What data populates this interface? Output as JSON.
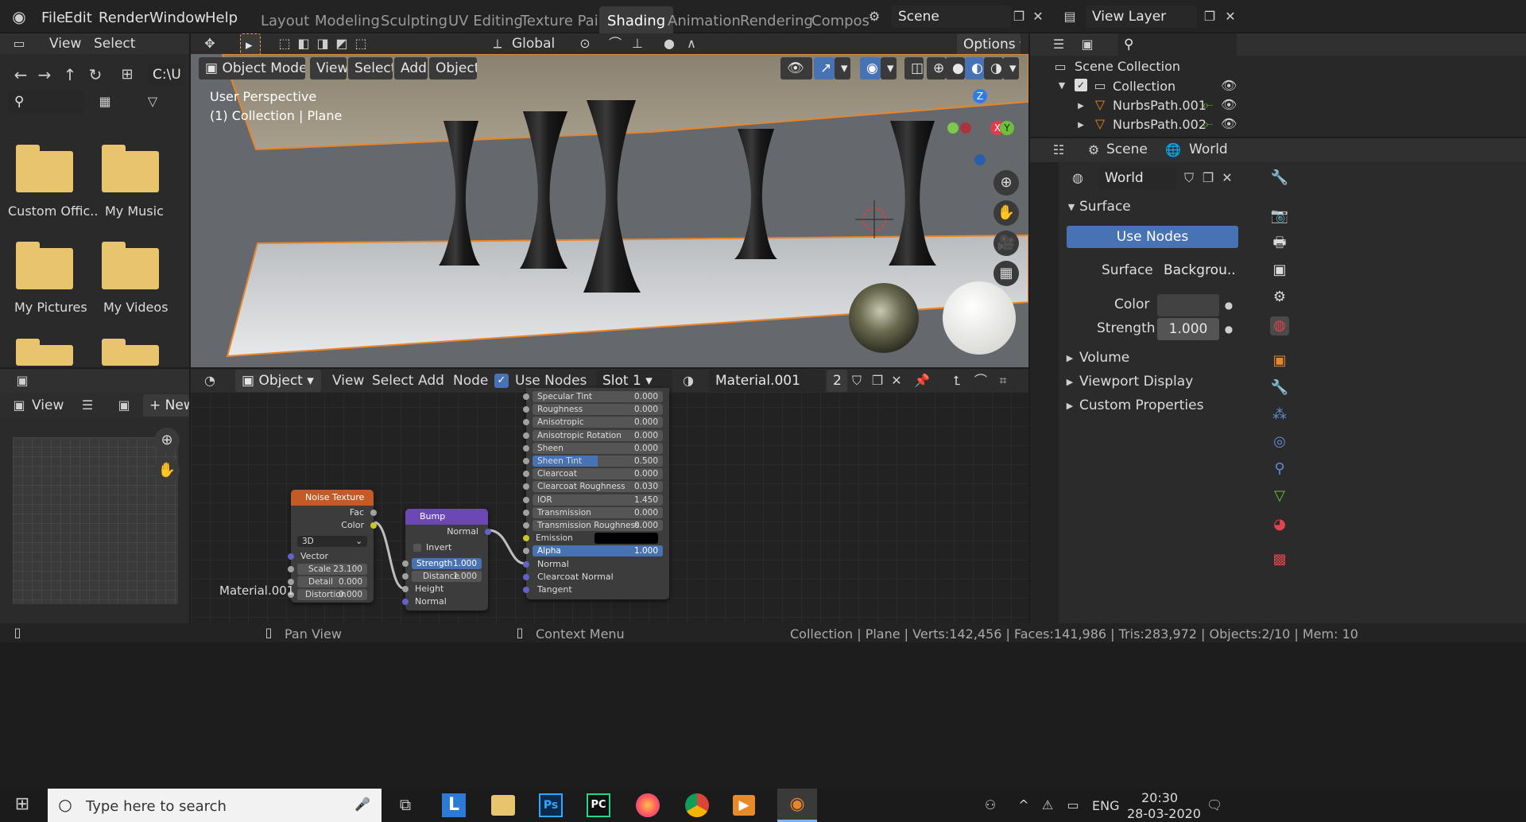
{
  "menu": [
    "File",
    "Edit",
    "Render",
    "Window",
    "Help"
  ],
  "workspaces": [
    "Layout",
    "Modeling",
    "Sculpting",
    "UV Editing",
    "Texture Paint",
    "Shading",
    "Animation",
    "Rendering",
    "Compos"
  ],
  "active_workspace": "Shading",
  "scene_name": "Scene",
  "view_layer": "View Layer",
  "file_browser": {
    "header_view": "View",
    "header_select": "Select",
    "path": "C:\\U",
    "folders": [
      "Custom Offic..",
      "My Music",
      "My Pictures",
      "My Videos",
      "",
      ""
    ]
  },
  "viewport": {
    "mode": "Object Mode",
    "menus": [
      "View",
      "Select",
      "Add",
      "Object"
    ],
    "orientation": "Global",
    "options": "Options",
    "overlay_line1": "User Perspective",
    "overlay_line2": "(1) Collection | Plane",
    "gizmo_z": "Z",
    "gizmo_x": "X",
    "gizmo_y": "Y"
  },
  "image_editor": {
    "view": "View",
    "new": "New"
  },
  "node_editor": {
    "object": "Object",
    "menus": [
      "View",
      "Select",
      "Add",
      "Node"
    ],
    "use_nodes": "Use Nodes",
    "slot": "Slot 1",
    "material": "Material.001",
    "users": "2",
    "material_label": "Material.001"
  },
  "bsdf_rows": [
    {
      "label": "Specular Tint",
      "value": "0.000"
    },
    {
      "label": "Roughness",
      "value": "0.000"
    },
    {
      "label": "Anisotropic",
      "value": "0.000"
    },
    {
      "label": "Anisotropic Rotation",
      "value": "0.000"
    },
    {
      "label": "Sheen",
      "value": "0.000"
    },
    {
      "label": "Sheen Tint",
      "value": "0.500"
    },
    {
      "label": "Clearcoat",
      "value": "0.000"
    },
    {
      "label": "Clearcoat Roughness",
      "value": "0.030"
    },
    {
      "label": "IOR",
      "value": "1.450"
    },
    {
      "label": "Transmission",
      "value": "0.000"
    },
    {
      "label": "Transmission Roughness",
      "value": "0.000"
    },
    {
      "label": "Emission",
      "value": ""
    },
    {
      "label": "Alpha",
      "value": "1.000"
    },
    {
      "label": "Normal",
      "value": ""
    },
    {
      "label": "Clearcoat Normal",
      "value": ""
    },
    {
      "label": "Tangent",
      "value": ""
    }
  ],
  "noise_node": {
    "title": "Noise Texture",
    "fac": "Fac",
    "color": "Color",
    "dim": "3D",
    "vector": "Vector",
    "scale_label": "Scale",
    "scale": "23.100",
    "detail_label": "Detail",
    "detail": "0.000",
    "distortion_label": "Distortion",
    "distortion": "0.000"
  },
  "bump_node": {
    "title": "Bump",
    "normal_out": "Normal",
    "invert": "Invert",
    "strength_label": "Strength",
    "strength": "1.000",
    "distance_label": "Distance",
    "distance": "1.000",
    "height": "Height",
    "normal_in": "Normal"
  },
  "outliner": {
    "scene_collection": "Scene Collection",
    "collection": "Collection",
    "items": [
      "NurbsPath.001",
      "NurbsPath.002"
    ]
  },
  "properties": {
    "tab_scene": "Scene",
    "tab_world": "World",
    "world_name": "World",
    "surface_panel": "Surface",
    "use_nodes": "Use Nodes",
    "surface_label": "Surface",
    "surface_value": "Backgrou..",
    "color_label": "Color",
    "strength_label": "Strength",
    "strength_value": "1.000",
    "panels": [
      "Volume",
      "Viewport Display",
      "Custom Properties"
    ]
  },
  "statusbar": {
    "pan": "Pan View",
    "context": "Context Menu",
    "stats": "Collection | Plane | Verts:142,456 | Faces:141,986 | Tris:283,972 | Objects:2/10 | Mem: 10"
  },
  "taskbar": {
    "search": "Type here to search",
    "lang": "ENG",
    "time": "20:30",
    "date": "28-03-2020"
  }
}
